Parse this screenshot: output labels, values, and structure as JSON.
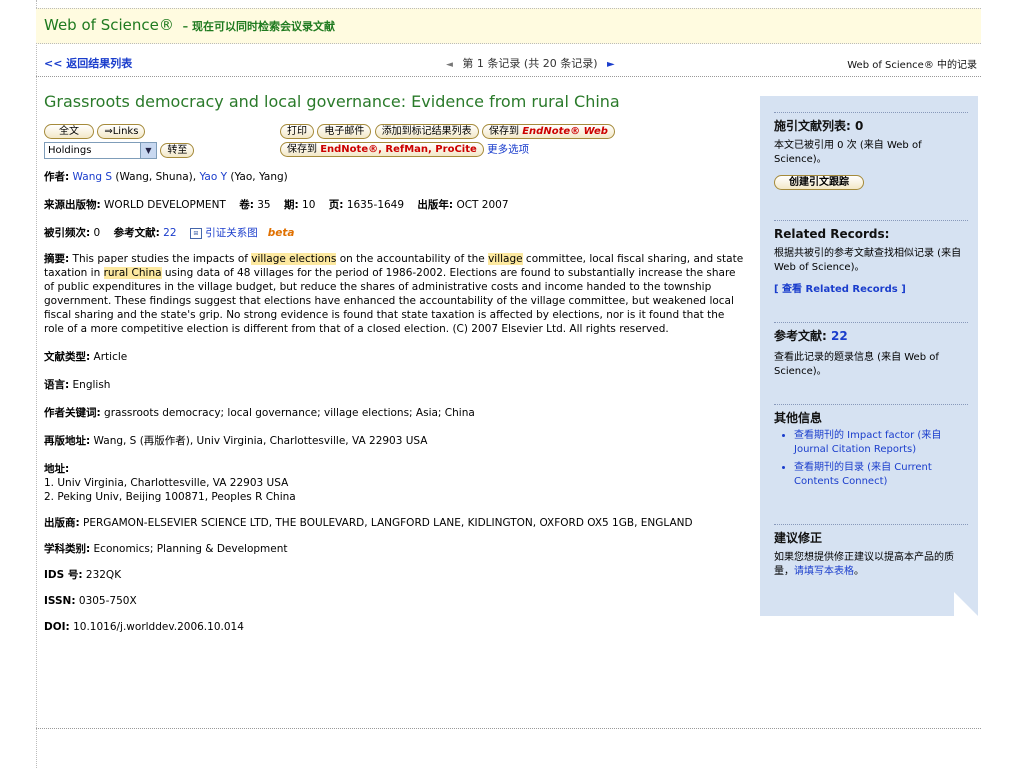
{
  "header": {
    "brand": "Web of Science®",
    "slogan": "– 现在可以同时检索会议录文献"
  },
  "nav": {
    "back_link": "<< 返回结果列表",
    "pager_text": "第 1 条记录 (共 20 条记录)",
    "right_text": "Web of Science® 中的记录"
  },
  "record": {
    "title": "Grassroots democracy and local governance: Evidence from rural China",
    "buttons": {
      "fulltext": "全文",
      "links": "⇒Links",
      "print": "打印",
      "email": "电子邮件",
      "add_marked": "添加到标记结果列表",
      "save_to": "保存到",
      "endnote_web": "EndNote® Web",
      "save_to2": "保存到",
      "save_formats": "EndNote®, RefMan, ProCite",
      "more_options": "更多选项",
      "go": "转至"
    },
    "holdings_select": "Holdings",
    "authors_label": "作者:",
    "author1": "Wang S",
    "author1_full": "(Wang, Shuna),",
    "author2": "Yao Y",
    "author2_full": "(Yao, Yang)",
    "source_label": "来源出版物:",
    "source_value": "WORLD DEVELOPMENT",
    "volume_label": "卷:",
    "volume_value": "35",
    "issue_label": "期:",
    "issue_value": "10",
    "pages_label": "页:",
    "pages_value": "1635-1649",
    "year_label": "出版年:",
    "year_value": "OCT 2007",
    "cited_label": "被引频次:",
    "cited_value": "0",
    "refs_label": "参考文献:",
    "refs_value": "22",
    "citation_map": "引证关系图",
    "beta": "beta",
    "abstract_label": "摘要:",
    "abstract_p1": "This paper studies the impacts of ",
    "abstract_h1": "village elections",
    "abstract_p2": " on the accountability of the ",
    "abstract_h2": "village",
    "abstract_p3": " committee, local fiscal sharing, and state taxation in ",
    "abstract_h3": "rural China",
    "abstract_p4": " using data of 48 villages for the period of 1986-2002. Elections are found to substantially increase the share of public expenditures in the village budget, but reduce the shares of administrative costs and income handed to the township government. These findings suggest that elections have enhanced the accountability of the village committee, but weakened local fiscal sharing and the state's grip. No strong evidence is found that state taxation is affected by elections, nor is it found that the role of a more competitive election is different from that of a closed election. (C) 2007 Elsevier Ltd. All rights reserved.",
    "doctype_label": "文献类型:",
    "doctype_value": "Article",
    "language_label": "语言:",
    "language_value": "English",
    "keywords_label": "作者关键词:",
    "keywords_value": "grassroots democracy; local governance; village elections; Asia; China",
    "reprint_label": "再版地址:",
    "reprint_value": "Wang, S (再版作者), Univ Virginia, Charlottesville, VA 22903 USA",
    "address_label": "地址:",
    "address1": "1. Univ Virginia, Charlottesville, VA 22903 USA",
    "address2": "2. Peking Univ, Beijing 100871, Peoples R China",
    "publisher_label": "出版商:",
    "publisher_value": "PERGAMON-ELSEVIER SCIENCE LTD, THE BOULEVARD, LANGFORD LANE, KIDLINGTON, OXFORD OX5 1GB, ENGLAND",
    "subject_label": "学科类别:",
    "subject_value": "Economics; Planning & Development",
    "ids_label": "IDS 号:",
    "ids_value": "232QK",
    "issn_label": "ISSN:",
    "issn_value": "0305-750X",
    "doi_label": "DOI:",
    "doi_value": "10.1016/j.worlddev.2006.10.014"
  },
  "sidebar": {
    "cited_title": "施引文献列表: 0",
    "cited_desc": "本文已被引用 0 次 (来自 Web of Science)。",
    "create_alert": "创建引文跟踪",
    "related_title": "Related Records:",
    "related_desc": "根据共被引的参考文献查找相似记录 (来自 Web of Science)。",
    "related_link": "[ 查看 Related Records ]",
    "refs_title": "参考文献:",
    "refs_count": "22",
    "refs_desc": "查看此记录的题录信息 (来自 Web of Science)。",
    "other_title": "其他信息",
    "other_item1": "查看期刊的 Impact factor (来自 Journal Citation Reports)",
    "other_item2": "查看期刊的目录 (来自 Current Contents Connect)",
    "suggest_title": "建议修正",
    "suggest_desc": "如果您想提供修正建议以提高本产品的质量，",
    "suggest_link": "请填写本表格",
    "suggest_end": "。"
  },
  "colors": {
    "brand_green": "#1f7a1f",
    "link_blue": "#1a3dcc",
    "highlight": "#fde9a0",
    "sidebar_bg": "#d6e2f2"
  }
}
